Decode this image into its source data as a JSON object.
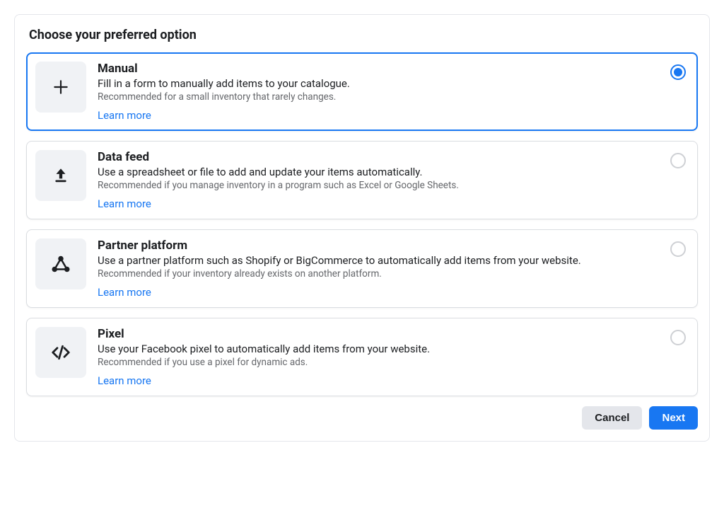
{
  "heading": "Choose your preferred option",
  "options": [
    {
      "title": "Manual",
      "desc": "Fill in a form to manually add items to your catalogue.",
      "hint": "Recommended for a small inventory that rarely changes.",
      "learn": "Learn more",
      "selected": true,
      "icon": "plus"
    },
    {
      "title": "Data feed",
      "desc": "Use a spreadsheet or file to add and update your items automatically.",
      "hint": "Recommended if you manage inventory in a program such as Excel or Google Sheets.",
      "learn": "Learn more",
      "selected": false,
      "icon": "upload"
    },
    {
      "title": "Partner platform",
      "desc": "Use a partner platform such as Shopify or BigCommerce to automatically add items from your website.",
      "hint": "Recommended if your inventory already exists on another platform.",
      "learn": "Learn more",
      "selected": false,
      "icon": "partner"
    },
    {
      "title": "Pixel",
      "desc": "Use your Facebook pixel to automatically add items from your website.",
      "hint": "Recommended if you use a pixel for dynamic ads.",
      "learn": "Learn more",
      "selected": false,
      "icon": "code"
    }
  ],
  "footer": {
    "cancel": "Cancel",
    "next": "Next"
  }
}
